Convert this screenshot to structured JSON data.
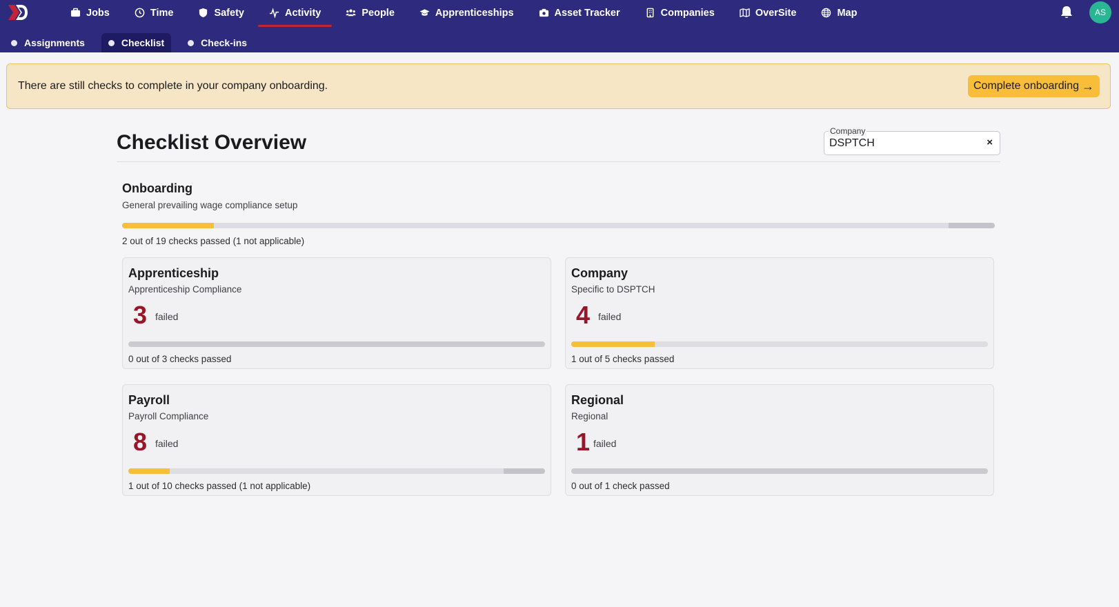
{
  "nav": {
    "items": [
      {
        "label": "Jobs",
        "icon": "briefcase-icon"
      },
      {
        "label": "Time",
        "icon": "clock-icon"
      },
      {
        "label": "Safety",
        "icon": "shield-icon"
      },
      {
        "label": "Activity",
        "icon": "activity-icon",
        "active": true
      },
      {
        "label": "People",
        "icon": "people-icon"
      },
      {
        "label": "Apprenticeships",
        "icon": "graduation-cap-icon"
      },
      {
        "label": "Asset Tracker",
        "icon": "camera-icon"
      },
      {
        "label": "Companies",
        "icon": "building-icon"
      },
      {
        "label": "OverSite",
        "icon": "map-outline-icon"
      },
      {
        "label": "Map",
        "icon": "globe-icon"
      }
    ],
    "avatar_initials": "AS"
  },
  "subnav": {
    "items": [
      {
        "label": "Assignments"
      },
      {
        "label": "Checklist",
        "active": true
      },
      {
        "label": "Check-ins"
      }
    ]
  },
  "banner": {
    "text": "There are still checks to complete in your company onboarding.",
    "button_label": "Complete onboarding",
    "button_arrow": "→"
  },
  "page": {
    "title": "Checklist Overview",
    "company_label": "Company",
    "company_value": "DSPTCH",
    "clear_label": "×"
  },
  "onboarding": {
    "title": "Onboarding",
    "subtitle": "General prevailing wage compliance setup",
    "passed": 2,
    "total": 19,
    "not_applicable": 1,
    "summary": "2 out of 19 checks passed (1 not applicable)"
  },
  "cards": [
    {
      "title": "Apprenticeship",
      "subtitle": "Apprenticeship Compliance",
      "failed_count": "3",
      "failed_label": "failed",
      "passed": 0,
      "total": 3,
      "not_applicable": 0,
      "summary": "0 out of 3 checks passed"
    },
    {
      "title": "Company",
      "subtitle": "Specific to DSPTCH",
      "failed_count": "4",
      "failed_label": "failed",
      "passed": 1,
      "total": 5,
      "not_applicable": 0,
      "summary": "1 out of 5 checks passed"
    },
    {
      "title": "Payroll",
      "subtitle": "Payroll Compliance",
      "failed_count": "8",
      "failed_label": "failed",
      "passed": 1,
      "total": 10,
      "not_applicable": 1,
      "summary": "1 out of 10 checks passed (1 not applicable)"
    },
    {
      "title": "Regional",
      "subtitle": "Regional",
      "failed_count": "1",
      "failed_label": "failed",
      "passed": 0,
      "total": 1,
      "not_applicable": 0,
      "summary": "0 out of 1 check passed"
    }
  ],
  "colors": {
    "topbar": "#2e2a7e",
    "active_underline": "#c22439",
    "progress_fill": "#f8be3a",
    "failed_count": "#98162a",
    "avatar": "#2ab595"
  }
}
